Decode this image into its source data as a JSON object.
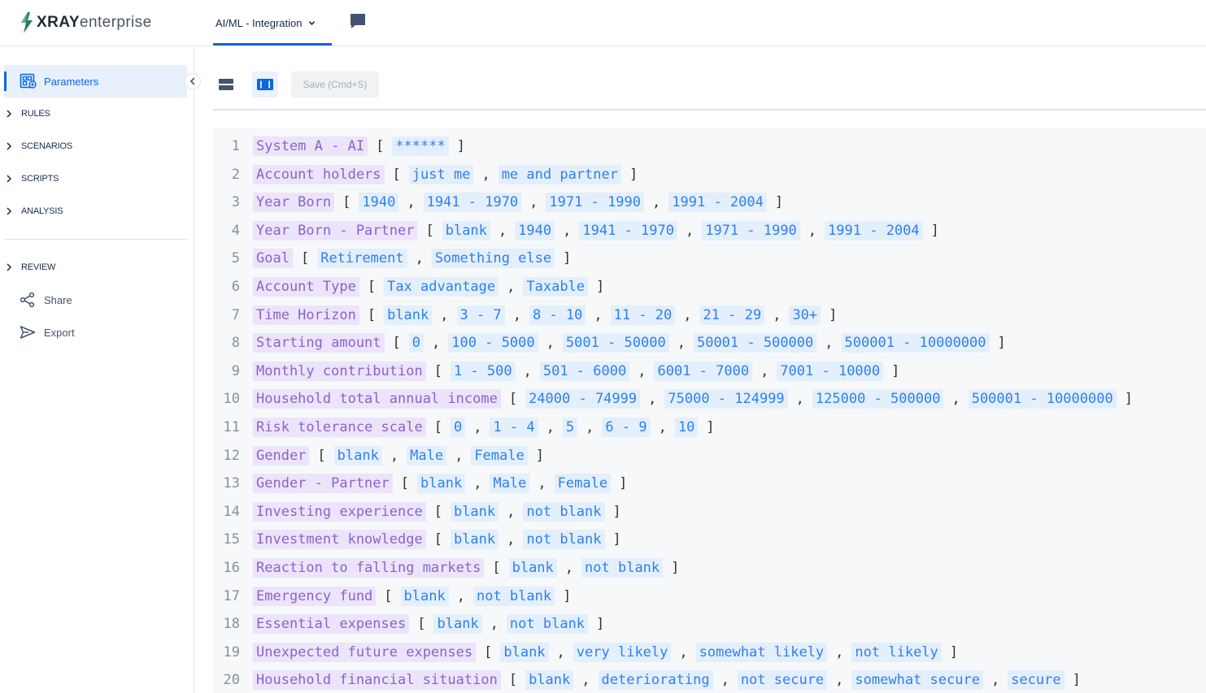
{
  "app": {
    "logo_primary": "XRAY",
    "logo_secondary": "enterprise",
    "project_label": "AI/ML - Integration"
  },
  "sidebar": {
    "active_item": "Parameters",
    "sections": [
      "RULES",
      "SCENARIOS",
      "SCRIPTS",
      "ANALYSIS"
    ],
    "review_label": "REVIEW",
    "review_items": [
      "Share",
      "Export"
    ]
  },
  "toolbar": {
    "save_label": "Save (Cmd+S)"
  },
  "editor": {
    "lines": [
      {
        "n": "1",
        "name": "System A - AI",
        "values": [
          "******"
        ]
      },
      {
        "n": "2",
        "name": "Account holders",
        "values": [
          "just me",
          "me and partner"
        ]
      },
      {
        "n": "3",
        "name": "Year Born",
        "values": [
          "1940",
          "1941 - 1970",
          "1971 - 1990",
          "1991 - 2004"
        ]
      },
      {
        "n": "4",
        "name": "Year Born - Partner",
        "values": [
          "blank",
          "1940",
          "1941 - 1970",
          "1971 - 1990",
          "1991 - 2004"
        ]
      },
      {
        "n": "5",
        "name": "Goal",
        "values": [
          "Retirement",
          "Something else"
        ]
      },
      {
        "n": "6",
        "name": "Account Type",
        "values": [
          "Tax advantage",
          "Taxable"
        ]
      },
      {
        "n": "7",
        "name": "Time Horizon",
        "values": [
          "blank",
          "3 - 7",
          "8 - 10",
          "11 - 20",
          "21 - 29",
          "30+"
        ]
      },
      {
        "n": "8",
        "name": "Starting amount",
        "values": [
          "0",
          "100 - 5000",
          "5001 - 50000",
          "50001 - 500000",
          "500001 - 10000000"
        ]
      },
      {
        "n": "9",
        "name": "Monthly contribution",
        "values": [
          "1 - 500",
          "501 - 6000",
          "6001 - 7000",
          "7001 - 10000"
        ]
      },
      {
        "n": "10",
        "name": "Household total annual income",
        "values": [
          "24000 - 74999",
          "75000 - 124999",
          "125000 - 500000",
          "500001 - 10000000"
        ]
      },
      {
        "n": "11",
        "name": "Risk tolerance scale",
        "values": [
          "0",
          "1 - 4",
          "5",
          "6 - 9",
          "10"
        ]
      },
      {
        "n": "12",
        "name": "Gender",
        "values": [
          "blank",
          "Male",
          "Female"
        ]
      },
      {
        "n": "13",
        "name": "Gender - Partner",
        "values": [
          "blank",
          "Male",
          "Female"
        ]
      },
      {
        "n": "14",
        "name": "Investing experience",
        "values": [
          "blank",
          "not blank"
        ]
      },
      {
        "n": "15",
        "name": "Investment knowledge",
        "values": [
          "blank",
          "not blank"
        ]
      },
      {
        "n": "16",
        "name": "Reaction to falling markets",
        "values": [
          "blank",
          "not blank"
        ]
      },
      {
        "n": "17",
        "name": "Emergency fund",
        "values": [
          "blank",
          "not blank"
        ]
      },
      {
        "n": "18",
        "name": "Essential expenses",
        "values": [
          "blank",
          "not blank"
        ]
      },
      {
        "n": "19",
        "name": "Unexpected future expenses",
        "values": [
          "blank",
          "very likely",
          "somewhat likely",
          "not likely"
        ]
      },
      {
        "n": "20",
        "name": "Household financial situation",
        "values": [
          "blank",
          "deteriorating",
          "not secure",
          "somewhat secure",
          "secure"
        ]
      }
    ]
  }
}
